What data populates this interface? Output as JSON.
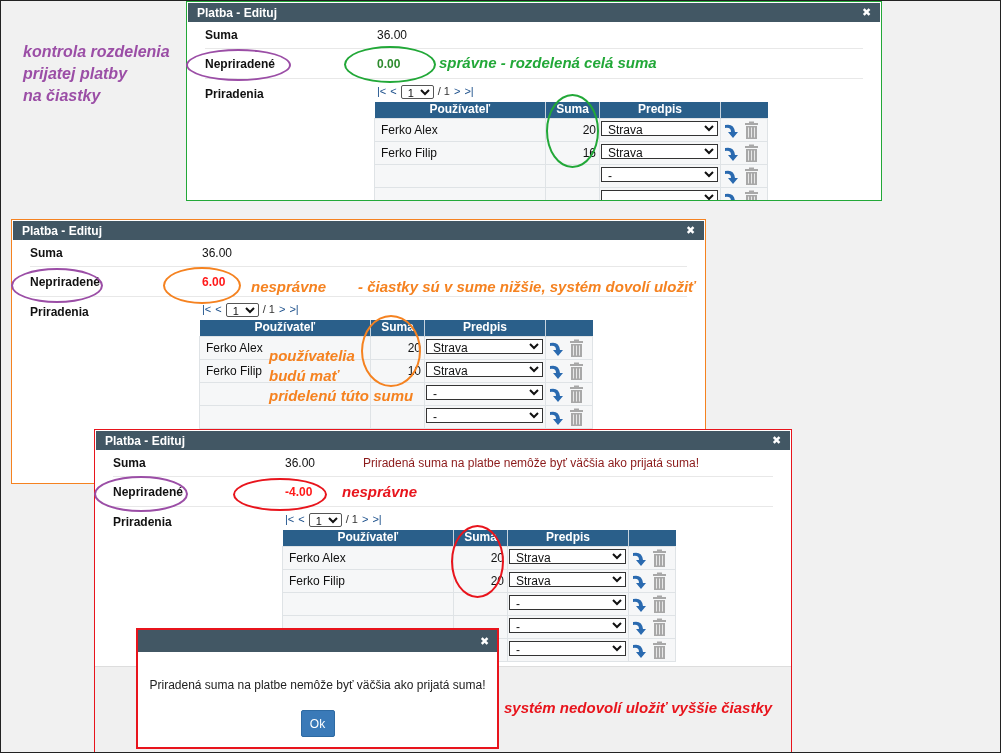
{
  "caption": [
    "kontrola rozdelenia",
    "prijatej platby",
    "na čiastky"
  ],
  "dialogs": [
    {
      "kind": "correct",
      "title": "Platba - Edituj",
      "close": "✖",
      "suma_label": "Suma",
      "suma": "36.00",
      "unassigned_label": "Nepriradené",
      "unassigned": "0.00",
      "assignments_label": "Priradenia",
      "pager": {
        "first": "|<",
        "prev": "<",
        "page": "1",
        "total": "/ 1",
        "next": ">",
        "last": ">|"
      },
      "columns": [
        "Používateľ",
        "Suma",
        "Predpis"
      ],
      "rows": [
        {
          "user": "Ferko Alex",
          "amount": "20",
          "predpis": "Strava"
        },
        {
          "user": "Ferko Filip",
          "amount": "16",
          "predpis": "Strava"
        },
        {
          "predpis": "-"
        },
        {}
      ],
      "notes": [
        "správne   -  rozdelená celá suma"
      ]
    },
    {
      "kind": "under",
      "title": "Platba - Edituj",
      "close": "✖",
      "suma_label": "Suma",
      "suma": "36.00",
      "unassigned_label": "Nepriradené",
      "unassigned": "6.00",
      "assignments_label": "Priradenia",
      "pager": {
        "first": "|<",
        "prev": "<",
        "page": "1",
        "total": "/ 1",
        "next": ">",
        "last": ">|"
      },
      "columns": [
        "Používateľ",
        "Suma",
        "Predpis"
      ],
      "rows": [
        {
          "user": "Ferko Alex",
          "amount": "20",
          "predpis": "Strava"
        },
        {
          "user": "Ferko Filip",
          "amount": "10",
          "predpis": "Strava"
        },
        {
          "predpis": "-"
        },
        {
          "predpis": "-"
        }
      ],
      "notes": [
        "nesprávne",
        "-   čiastky sú v sume nižšie, systém dovolí uložiť",
        "používatelia",
        "budú mať",
        "pridelenú túto sumu"
      ]
    },
    {
      "kind": "over",
      "title": "Platba - Edituj",
      "close": "✖",
      "suma_label": "Suma",
      "suma": "36.00",
      "error": "Priradená suma na platbe nemôže byť väčšia ako prijatá suma!",
      "unassigned_label": "Nepriradené",
      "unassigned": "-4.00",
      "assignments_label": "Priradenia",
      "pager": {
        "first": "|<",
        "prev": "<",
        "page": "1",
        "total": "/ 1",
        "next": ">",
        "last": ">|"
      },
      "columns": [
        "Používateľ",
        "Suma",
        "Predpis"
      ],
      "rows": [
        {
          "user": "Ferko Alex",
          "amount": "20",
          "predpis": "Strava"
        },
        {
          "user": "Ferko Filip",
          "amount": "20",
          "predpis": "Strava"
        },
        {
          "predpis": "-"
        },
        {
          "predpis": "-"
        },
        {
          "predpis": "-"
        }
      ],
      "notes": [
        "nesprávne",
        "systém nedovolí uložiť  vyššie čiastky"
      ],
      "alert": {
        "close": "✖",
        "message": "Priradená suma na platbe nemôže byť väčšia ako prijatá suma!",
        "button": "Ok"
      }
    }
  ]
}
